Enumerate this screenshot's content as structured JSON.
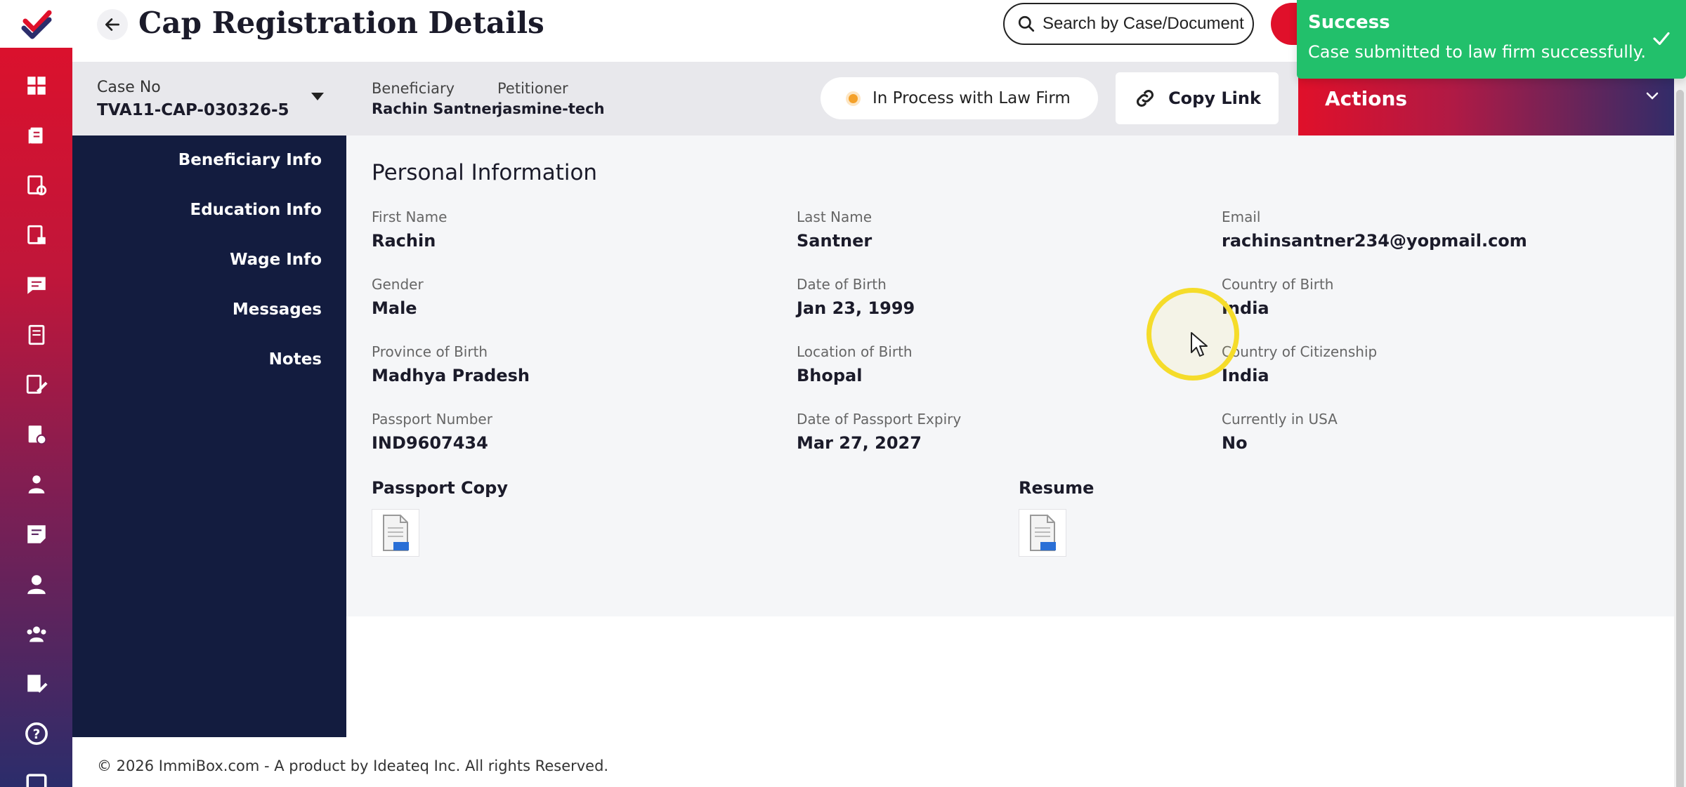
{
  "header": {
    "title": "Cap Registration Details",
    "search_placeholder": "Search by Case/Document"
  },
  "rail": {
    "icons": [
      "logo-icon",
      "dashboard-icon",
      "documents-icon",
      "doc-settings-icon",
      "doc-lock-icon",
      "chat-icon",
      "book-icon",
      "edit-doc-icon",
      "doc-check-icon",
      "user-icon",
      "notes-icon",
      "person-icon",
      "group-icon",
      "form-edit-icon",
      "help-icon",
      "more-icon"
    ]
  },
  "casebar": {
    "case_no_label": "Case No",
    "case_no_value": "TVA11-CAP-030326-5",
    "beneficiary_label": "Beneficiary",
    "beneficiary_value": "Rachin Santner",
    "petitioner_label": "Petitioner",
    "petitioner_value": "jasmine-tech",
    "status": "In Process with Law Firm",
    "status_color": "#f4a12a",
    "copy_link": "Copy Link",
    "actions": "Actions"
  },
  "subnav": {
    "items": [
      "Beneficiary Info",
      "Education Info",
      "Wage Info",
      "Messages",
      "Notes"
    ],
    "active": "Beneficiary Info"
  },
  "personal": {
    "title": "Personal Information",
    "first_name_label": "First Name",
    "first_name": "Rachin",
    "last_name_label": "Last Name",
    "last_name": "Santner",
    "email_label": "Email",
    "email": "rachinsantner234@yopmail.com",
    "gender_label": "Gender",
    "gender": "Male",
    "dob_label": "Date of Birth",
    "dob": "Jan 23, 1999",
    "country_birth_label": "Country of Birth",
    "country_birth": "India",
    "province_label": "Province of Birth",
    "province": "Madhya Pradesh",
    "location_label": "Location of Birth",
    "location": "Bhopal",
    "citizenship_label": "Country of Citizenship",
    "citizenship": "India",
    "passport_label": "Passport Number",
    "passport": "IND9607434",
    "passport_expiry_label": "Date of Passport Expiry",
    "passport_expiry": "Mar 27, 2027",
    "in_usa_label": "Currently in USA",
    "in_usa": "No"
  },
  "documents": {
    "passport_copy": "Passport Copy",
    "resume": "Resume"
  },
  "footer": {
    "text": "© 2026 ImmiBox.com - A product by Ideateq Inc. All rights Reserved."
  },
  "toast": {
    "title": "Success",
    "message": "Case submitted to law firm successfully.",
    "color": "#22c06b"
  }
}
